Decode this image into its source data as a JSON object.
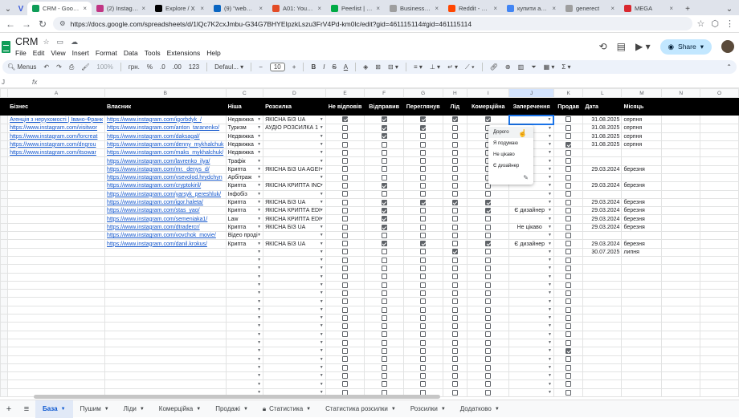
{
  "browser": {
    "tabs": [
      {
        "title": "CRM - Google",
        "color": "#0f9d58",
        "active": true
      },
      {
        "title": "(2) Instagram",
        "color": "#c13584"
      },
      {
        "title": "Explore / X",
        "color": "#000000"
      },
      {
        "title": "(9) \"web3\" | L",
        "color": "#0a66c2"
      },
      {
        "title": "A01: Your pr",
        "color": "#e34c26"
      },
      {
        "title": "Peerlist | The",
        "color": "#00aa45"
      },
      {
        "title": "Business Mar",
        "color": "#9e9e9e"
      },
      {
        "title": "Reddit - https",
        "color": "#ff4500"
      },
      {
        "title": "купити акка",
        "color": "#4285f4"
      },
      {
        "title": "generect",
        "color": "#9e9e9e"
      },
      {
        "title": "MEGA",
        "color": "#d9272e"
      }
    ],
    "url": "https://docs.google.com/spreadsheets/d/1lQc7K2cxJmbu-G34G7BHYEIpzkLszu3FrV4Pd-km0lc/edit?gid=461115114#gid=461115114"
  },
  "app": {
    "title": "CRM",
    "menus": [
      "File",
      "Edit",
      "View",
      "Insert",
      "Format",
      "Data",
      "Tools",
      "Extensions",
      "Help"
    ],
    "share_label": "Share"
  },
  "toolbar": {
    "menus_label": "Menus",
    "zoom": "100%",
    "currency": "грн.",
    "pct": "%",
    "dec1": ".0",
    "dec2": ".00",
    "num": "123",
    "font": "Defaul...",
    "size": "10"
  },
  "formula": {
    "ref": "J",
    "fx": "fx"
  },
  "columns": [
    "A",
    "B",
    "C",
    "D",
    "E",
    "F",
    "G",
    "H",
    "I",
    "J",
    "K",
    "L",
    "M",
    "N",
    "O"
  ],
  "headers": [
    "Бізнес",
    "Власник",
    "Ніша",
    "Розсилка",
    "Не відповів",
    "Відправив",
    "Переглянув",
    "Лід",
    "Комерційна",
    "Заперечення",
    "Продав",
    "Дата",
    "Місяць",
    "",
    ""
  ],
  "rows": [
    {
      "a": "Агенція з нерухомості | Івано-Франк",
      "b": "https://www.instagram.com/igorbdyk_/",
      "c": "Недвижка",
      "d": "ЯКІСНА БІЗ UA",
      "e": 1,
      "f": 1,
      "g": 1,
      "h": 1,
      "i": 1,
      "j": "",
      "k": 0,
      "l": "31.08.2025",
      "m": "серпня"
    },
    {
      "a": "https://www.instagram.com/visitwor",
      "b": "https://www.instagram.com/anton_taranenko/",
      "c": "Туризм",
      "d": "АУДІО РОЗСИЛКА 1",
      "e": 0,
      "f": 1,
      "g": 1,
      "h": 0,
      "i": 0,
      "j": "",
      "k": 0,
      "l": "31.08.2025",
      "m": "серпня"
    },
    {
      "a": "https://www.instagram.com/forcreat",
      "b": "https://www.instagram.com/daksagal/",
      "c": "Недвижка",
      "d": "",
      "e": 0,
      "f": 1,
      "g": 0,
      "h": 0,
      "i": 0,
      "j": "",
      "k": 0,
      "l": "31.08.2025",
      "m": "серпня"
    },
    {
      "a": "https://www.instagram.com/dngrou",
      "b": "https://www.instagram.com/denny_mykhalchuk",
      "c": "Недвижка",
      "d": "",
      "e": 0,
      "f": 0,
      "g": 0,
      "h": 0,
      "i": 0,
      "j": "",
      "k": 1,
      "l": "31.08.2025",
      "m": "серпня"
    },
    {
      "a": "https://www.instagram.com/itsowar",
      "b": "https://www.instagram.com/maks_mykhalchuk/",
      "c": "Недвижка",
      "d": "",
      "e": 0,
      "f": 0,
      "g": 0,
      "h": 0,
      "i": 0,
      "j": "",
      "k": 0,
      "l": "",
      "m": ""
    },
    {
      "a": "",
      "b": "https://www.instagram.com/lavrenko_ilya/",
      "c": "Трафік",
      "d": "",
      "e": 0,
      "f": 0,
      "g": 0,
      "h": 0,
      "i": 0,
      "j": "",
      "k": 0,
      "l": "",
      "m": ""
    },
    {
      "a": "",
      "b": "https://www.instagram.com/mr._denys_d/",
      "c": "Крипта",
      "d": "ЯКІСНА БІЗ UA AGEI",
      "e": 0,
      "f": 0,
      "g": 0,
      "h": 0,
      "i": 0,
      "j": "",
      "k": 0,
      "l": "29.03.2024",
      "m": "березня"
    },
    {
      "a": "",
      "b": "https://www.instagram.com/vsevolod.hrydchyn",
      "c": "Арбітраж",
      "d": "",
      "e": 0,
      "f": 0,
      "g": 0,
      "h": 0,
      "i": 0,
      "j": "",
      "k": 0,
      "l": "",
      "m": ""
    },
    {
      "a": "",
      "b": "https://www.instagram.com/cryptokiril/",
      "c": "Крипта",
      "d": "ЯКІСНА КРИПТА INC",
      "e": 0,
      "f": 1,
      "g": 0,
      "h": 0,
      "i": 0,
      "j": "",
      "k": 0,
      "l": "29.03.2024",
      "m": "березня"
    },
    {
      "a": "",
      "b": "https://www.instagram.com/yarsyk_pereshluk/",
      "c": "Інфобіз",
      "d": "",
      "e": 0,
      "f": 0,
      "g": 0,
      "h": 0,
      "i": 0,
      "j": "",
      "k": 0,
      "l": "",
      "m": ""
    },
    {
      "a": "",
      "b": "https://www.instagram.com/igor.haleta/",
      "c": "Крипта",
      "d": "ЯКІСНА БІЗ UA",
      "e": 0,
      "f": 1,
      "g": 1,
      "h": 1,
      "i": 1,
      "j": "",
      "k": 0,
      "l": "29.03.2024",
      "m": "березня"
    },
    {
      "a": "",
      "b": "https://www.instagram.com/stas_yao/",
      "c": "Крипта",
      "d": "ЯКІСНА КРИПТА EDI",
      "e": 0,
      "f": 1,
      "g": 0,
      "h": 0,
      "i": 1,
      "j": "Є дизайнер",
      "k": 0,
      "l": "29.03.2024",
      "m": "березня"
    },
    {
      "a": "",
      "b": "https://www.instagram.com/semeniaka1/",
      "c": "Law",
      "d": "ЯКІСНА КРИПТА EDI",
      "e": 0,
      "f": 1,
      "g": 0,
      "h": 0,
      "i": 0,
      "j": "",
      "k": 0,
      "l": "29.03.2024",
      "m": "березня"
    },
    {
      "a": "",
      "b": "https://www.instagram.com/dtradercr/",
      "c": "Крипта",
      "d": "ЯКІСНА БІЗ UA",
      "e": 0,
      "f": 1,
      "g": 0,
      "h": 0,
      "i": 0,
      "j": "Не цікаво",
      "k": 0,
      "l": "29.03.2024",
      "m": "березня"
    },
    {
      "a": "",
      "b": "https://www.instagram.com/vovchok_movie/",
      "c": "Відео проді",
      "d": "",
      "e": 0,
      "f": 0,
      "g": 0,
      "h": 0,
      "i": 0,
      "j": "",
      "k": 0,
      "l": "",
      "m": ""
    },
    {
      "a": "",
      "b": "https://www.instagram.com/danil.krokus/",
      "c": "Крипта",
      "d": "ЯКІСНА БІЗ UA",
      "e": 0,
      "f": 1,
      "g": 1,
      "h": 0,
      "i": 1,
      "j": "Є дизайнер",
      "k": 0,
      "l": "29.03.2024",
      "m": "березня"
    },
    {
      "a": "",
      "b": "",
      "c": "",
      "d": "",
      "e": 0,
      "f": 0,
      "g": 0,
      "h": 1,
      "i": 0,
      "j": "",
      "k": 0,
      "l": "30.07.2025",
      "m": "липня"
    }
  ],
  "popup": {
    "options": [
      "Дорого",
      "Я подумаю",
      "Не цікаво",
      "Є дизайнер"
    ]
  },
  "sheets": [
    {
      "name": "База",
      "active": true
    },
    {
      "name": "Пушим"
    },
    {
      "name": "Ліди"
    },
    {
      "name": "Комерційка"
    },
    {
      "name": "Продажі"
    },
    {
      "name": "Статистика",
      "locked": true
    },
    {
      "name": "Статистика розсилки"
    },
    {
      "name": "Розсилки"
    },
    {
      "name": "Додатково"
    }
  ]
}
